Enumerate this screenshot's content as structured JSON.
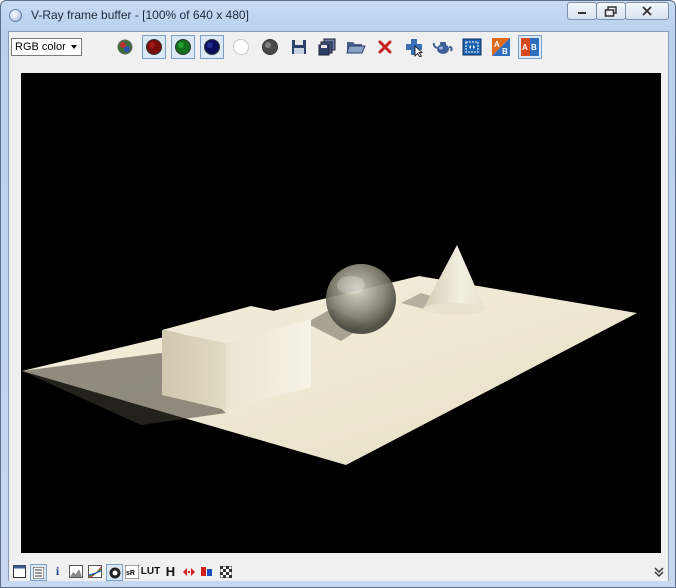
{
  "window": {
    "title": "V-Ray frame buffer - [100% of 640 x 480]"
  },
  "toolbar": {
    "channel_select_value": "RGB color",
    "buttons": [
      "rgb-channels-icon",
      "red-channel-icon",
      "green-channel-icon",
      "blue-channel-icon",
      "alpha-channel-icon",
      "monochrome-icon",
      "save-image-icon",
      "save-all-channels-icon",
      "load-image-icon",
      "clear-image-icon",
      "track-mouse-icon",
      "render-icon",
      "region-render-icon",
      "ab-compare-horizontal-icon",
      "ab-compare-vertical-icon"
    ]
  },
  "statusbar": {
    "info_label": "i",
    "lut_label": "LUT",
    "h_label": "H"
  },
  "colors": {
    "title_gradient": "#b9d1ee",
    "render_background": "#000000",
    "ground_plane": "#f2ecd8"
  }
}
